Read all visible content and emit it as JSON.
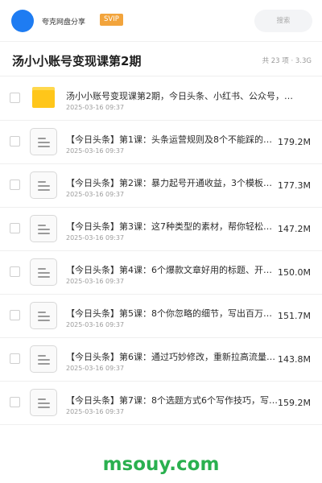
{
  "header": {
    "username": "夸克网盘分享",
    "badge": "SVIP",
    "search_placeholder": "搜索",
    "avatar_color": "#1e7cf2"
  },
  "share": {
    "title": "汤小小账号变现课第2期",
    "meta": "共 23 项 · 3.3G"
  },
  "files": [
    {
      "type": "folder",
      "name": "汤小小账号变现课第2期，今日头条、小红书、公众号，…",
      "date": "2025-03-16 09:37",
      "size": ""
    },
    {
      "type": "doc",
      "name": "【今日头条】第1课：头条运营规则及8个不能踩的坑…",
      "date": "2025-03-16 09:37",
      "size": "179.2M"
    },
    {
      "type": "doc",
      "name": "【今日头条】第2课：暴力起号开通收益，3个模板就够…",
      "date": "2025-03-16 09:37",
      "size": "177.3M"
    },
    {
      "type": "doc",
      "name": "【今日头条】第3课：这7种类型的素材，帮你轻松写出…",
      "date": "2025-03-16 09:37",
      "size": "147.2M"
    },
    {
      "type": "doc",
      "name": "【今日头条】第4课：6个爆款文章好用的标题、开头和…",
      "date": "2025-03-16 09:37",
      "size": "150.0M"
    },
    {
      "type": "doc",
      "name": "【今日头条】第5课：8个你忽略的细节，写出百万爆款…",
      "date": "2025-03-16 09:37",
      "size": "151.7M"
    },
    {
      "type": "doc",
      "name": "【今日头条】第6课：通过巧妙修改，重新拉高流量出爆…",
      "date": "2025-03-16 09:37",
      "size": "143.8M"
    },
    {
      "type": "doc",
      "name": "【今日头条】第7课：8个选题方式6个写作技巧，写出…",
      "date": "2025-03-16 09:37",
      "size": "159.2M"
    }
  ],
  "watermark": "msouy.com"
}
